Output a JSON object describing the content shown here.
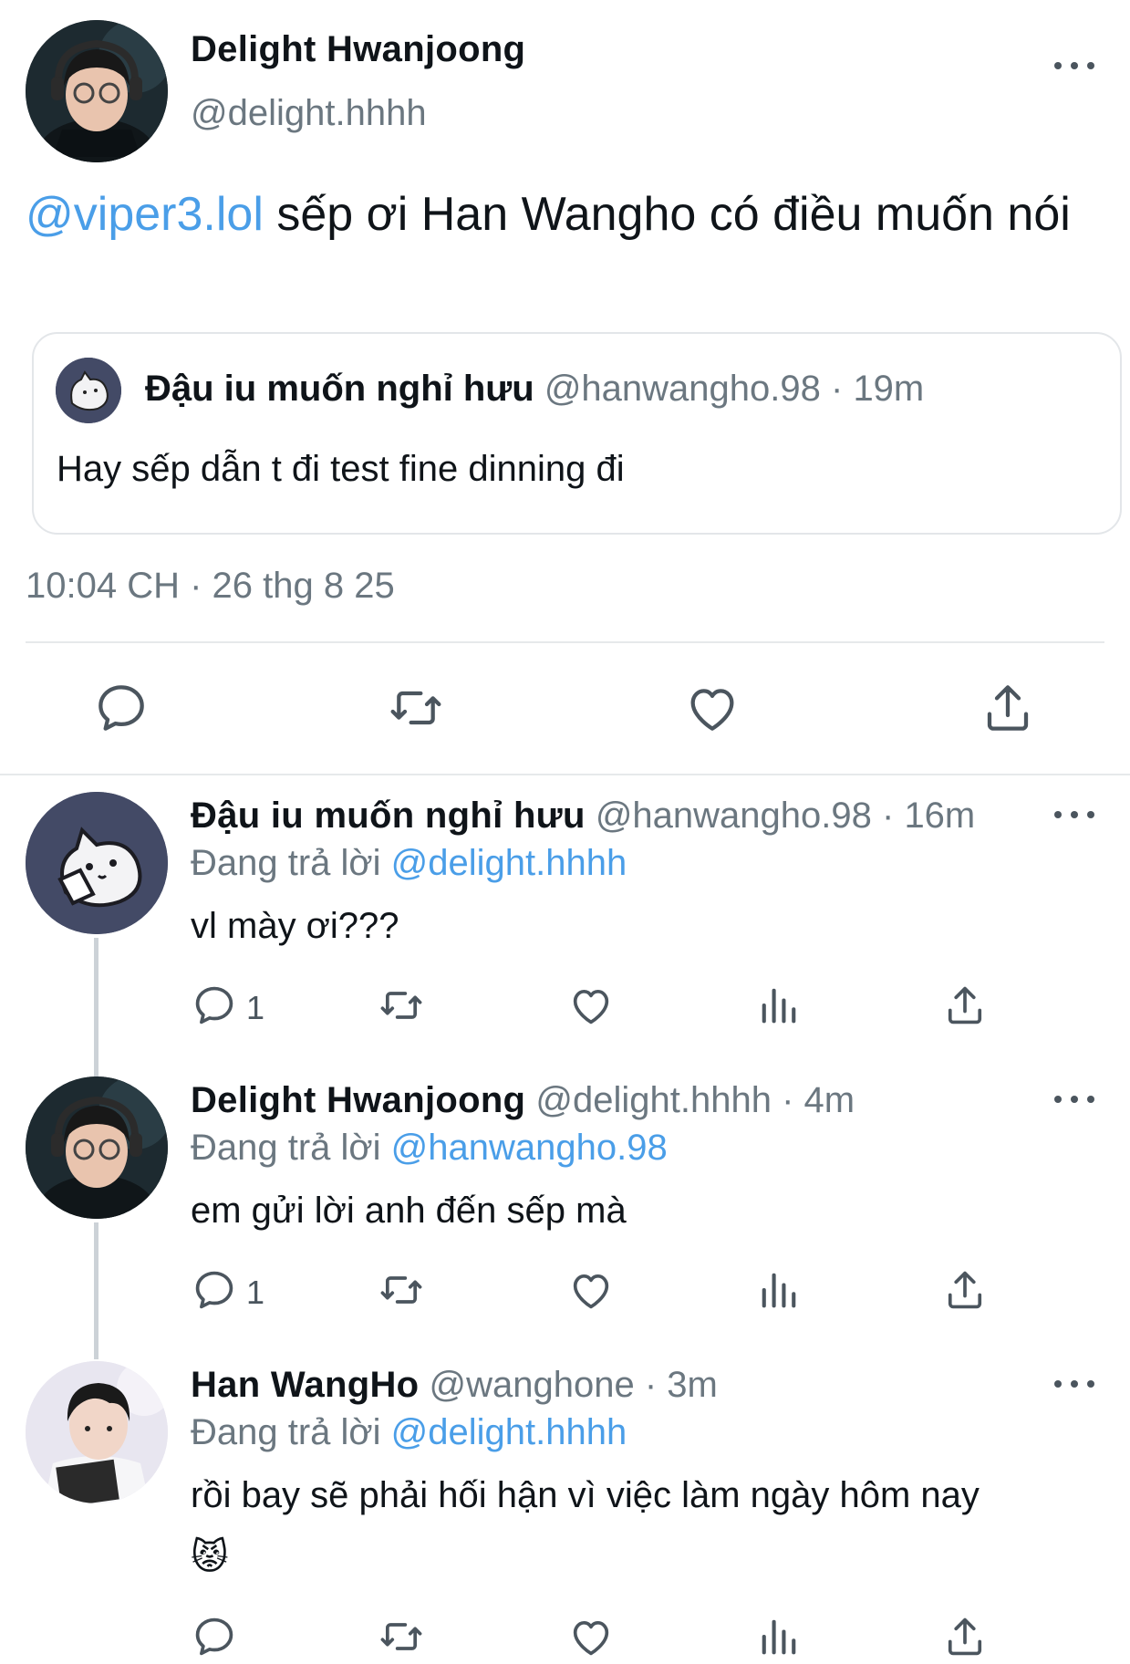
{
  "main_tweet": {
    "author_name": "Delight Hwanjoong",
    "author_handle": "@delight.hhhh",
    "mention": "@viper3.lol",
    "text": " sếp ơi Han Wangho có điều muốn nói",
    "quote": {
      "author_name": "Đậu iu muốn nghỉ hưu",
      "author_handle": "@hanwangho.98",
      "time": " · 19m",
      "text": "Hay sếp dẫn t đi test fine dinning đi"
    },
    "timestamp": "10:04 CH · 26 thg 8 25",
    "actions": [
      "reply-icon",
      "retweet-icon",
      "like-icon",
      "share-icon"
    ]
  },
  "replies": [
    {
      "author_name": "Đậu iu muốn nghỉ hưu",
      "author_handle": "@hanwangho.98",
      "time": " · 16m",
      "replying_label": "Đang trả lời ",
      "replying_to": "@delight.hhhh",
      "text": "vl mày ơi???",
      "emoji": "",
      "reply_count": "1"
    },
    {
      "author_name": "Delight Hwanjoong",
      "author_handle": "@delight.hhhh",
      "time": " · 4m",
      "replying_label": "Đang trả lời ",
      "replying_to": "@hanwangho.98",
      "text": "em gửi lời anh đến sếp mà",
      "emoji": "",
      "reply_count": "1"
    },
    {
      "author_name": "Han WangHo",
      "author_handle": "@wanghone",
      "time": " · 3m",
      "replying_label": "Đang trả lời ",
      "replying_to": "@delight.hhhh",
      "text": "rồi bay sẽ phải hối hận vì việc làm ngày hôm nay",
      "emoji": "😾",
      "reply_count": ""
    }
  ],
  "colors": {
    "link": "#4a9ee8",
    "secondary_text": "#6b7780",
    "icon": "#4b555e",
    "divider": "#e6e9eb"
  }
}
